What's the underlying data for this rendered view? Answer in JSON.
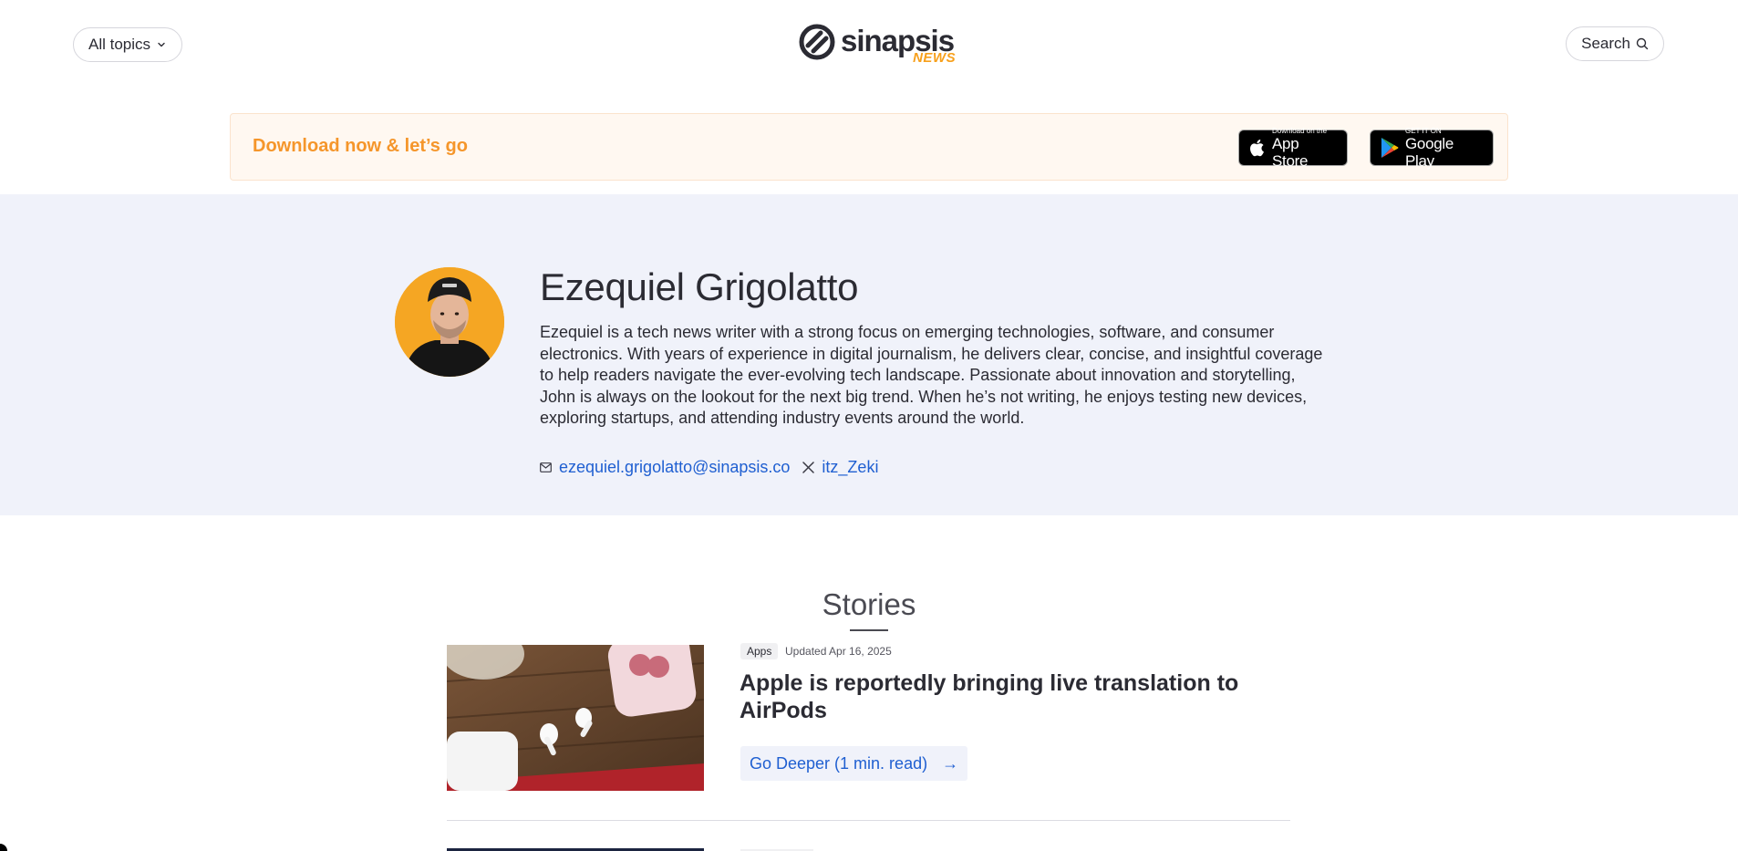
{
  "header": {
    "topics_label": "All topics",
    "search_label": "Search",
    "logo_main": "sinapsis",
    "logo_sub": "NEWS"
  },
  "banner": {
    "text": "Download now & let’s go",
    "appstore_small": "Download on the",
    "appstore_big": "App Store",
    "googleplay_small": "GET IT ON",
    "googleplay_big": "Google Play"
  },
  "author": {
    "name": "Ezequiel Grigolatto",
    "bio": "Ezequiel is a tech news writer with a strong focus on emerging technologies, software, and consumer electronics. With years of experience in digital journalism, he delivers clear, concise, and insightful coverage to help readers navigate the ever-evolving tech landscape. Passionate about innovation and storytelling, John is always on the lookout for the next big trend. When he’s not writing, he enjoys testing new devices, exploring startups, and attending industry events around the world.",
    "email": "ezequiel.grigolatto@sinapsis.co",
    "x_handle": "itz_Zeki"
  },
  "stories": {
    "title": "Stories",
    "items": [
      {
        "tag": "Apps",
        "updated": "Updated Apr 16, 2025",
        "title": "Apple is reportedly bringing live translation to AirPods",
        "cta": "Go Deeper (1 min. read)",
        "cta_arrow": "→"
      }
    ]
  },
  "colors": {
    "accent": "#f5962b",
    "link": "#1f5fd1",
    "profile_bg": "#f0f2fa"
  }
}
